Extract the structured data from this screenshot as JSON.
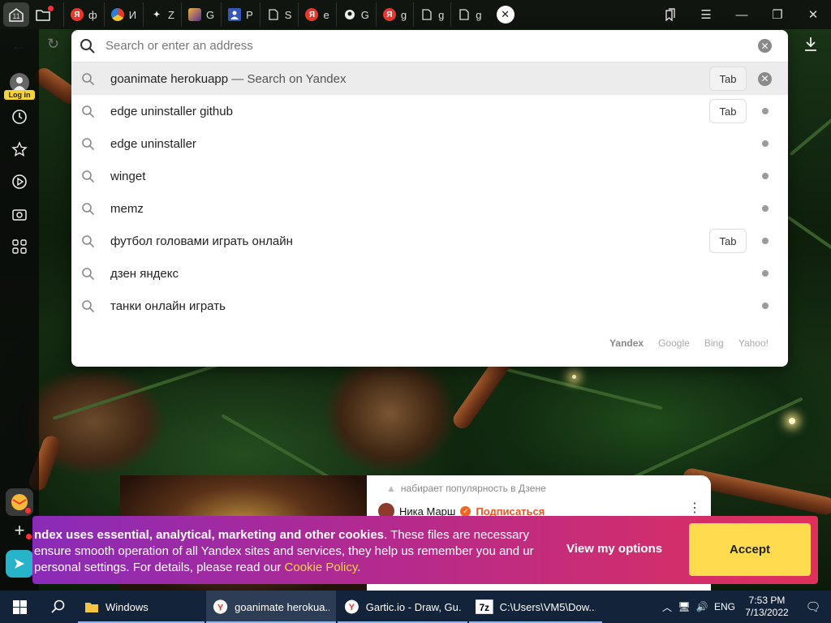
{
  "tabbar": {
    "tabs_count_badge": "11",
    "tabs": [
      {
        "favicon": "yandex-icon",
        "color": "#e8382e",
        "glyph": "Я",
        "label": "ф"
      },
      {
        "favicon": "colorful-circle-icon",
        "color": "#e33c2a",
        "glyph": "",
        "label": "И"
      },
      {
        "favicon": "star-sparkle-icon",
        "color": "#101510",
        "glyph": "✦",
        "label": "Z"
      },
      {
        "favicon": "game-icon",
        "color": "#5a2fa0",
        "glyph": "",
        "label": "G"
      },
      {
        "favicon": "person-icon",
        "color": "#3657b8",
        "glyph": "",
        "label": "P"
      },
      {
        "favicon": "document-icon",
        "color": "#101510",
        "glyph": "",
        "label": "S"
      },
      {
        "favicon": "yandex-icon",
        "color": "#e8382e",
        "glyph": "Я",
        "label": "e"
      },
      {
        "favicon": "github-icon",
        "color": "#101510",
        "glyph": "",
        "label": "G"
      },
      {
        "favicon": "yandex-icon",
        "color": "#e8382e",
        "glyph": "Я",
        "label": "g"
      },
      {
        "favicon": "document-icon",
        "color": "#101510",
        "glyph": "",
        "label": "g"
      },
      {
        "favicon": "document-icon",
        "color": "#101510",
        "glyph": "",
        "label": "g"
      }
    ]
  },
  "sidebar": {
    "login_label": "Log in"
  },
  "omnibox": {
    "placeholder": "Search or enter an address",
    "suggestions": [
      {
        "text": "goanimate herokuapp",
        "suffix": " — Search on Yandex",
        "tab": "Tab",
        "active": true
      },
      {
        "text": "edge uninstaller github",
        "suffix": "",
        "tab": "Tab",
        "active": false
      },
      {
        "text": "edge uninstaller",
        "suffix": "",
        "tab": "",
        "active": false
      },
      {
        "text": "winget",
        "suffix": "",
        "tab": "",
        "active": false
      },
      {
        "text": "memz",
        "suffix": "",
        "tab": "",
        "active": false
      },
      {
        "text": "футбол головами играть онлайн",
        "suffix": "",
        "tab": "Tab",
        "active": false
      },
      {
        "text": "дзен яндекс",
        "suffix": "",
        "tab": "",
        "active": false
      },
      {
        "text": "танки онлайн играть",
        "suffix": "",
        "tab": "",
        "active": false
      }
    ],
    "engines": [
      "Yandex",
      "Google",
      "Bing",
      "Yahoo!"
    ]
  },
  "zen": {
    "trending": "набирает популярность в Дзене",
    "author": "Ника Марш",
    "subscribe": "Подписаться"
  },
  "cookie": {
    "bold": "ndex uses essential, analytical, marketing and other cookies",
    "text": ". These files are necessary ensure smooth operation of all Yandex sites and services, they help us remember you and ur personal settings. For details, please read our ",
    "link": "Cookie Policy",
    "end": ".",
    "view_options": "View my options",
    "accept": "Accept"
  },
  "taskbar": {
    "items": [
      {
        "icon": "folder-icon",
        "label": "Windows",
        "active": false
      },
      {
        "icon": "yandex-browser-icon",
        "label": "goanimate herokua...",
        "active": true
      },
      {
        "icon": "yandex-browser-icon",
        "label": "Gartic.io - Draw, Gu...",
        "active": false
      },
      {
        "icon": "7zip-icon",
        "label": "C:\\Users\\VM5\\Dow...",
        "active": false
      }
    ],
    "language": "ENG",
    "time": "7:53 PM",
    "date": "7/13/2022"
  },
  "colors": {
    "accent_yellow": "#ffdb4d",
    "cookie_gradient_start": "#8a2bb8",
    "cookie_gradient_end": "#e0305a",
    "taskbar": "#13233a"
  }
}
